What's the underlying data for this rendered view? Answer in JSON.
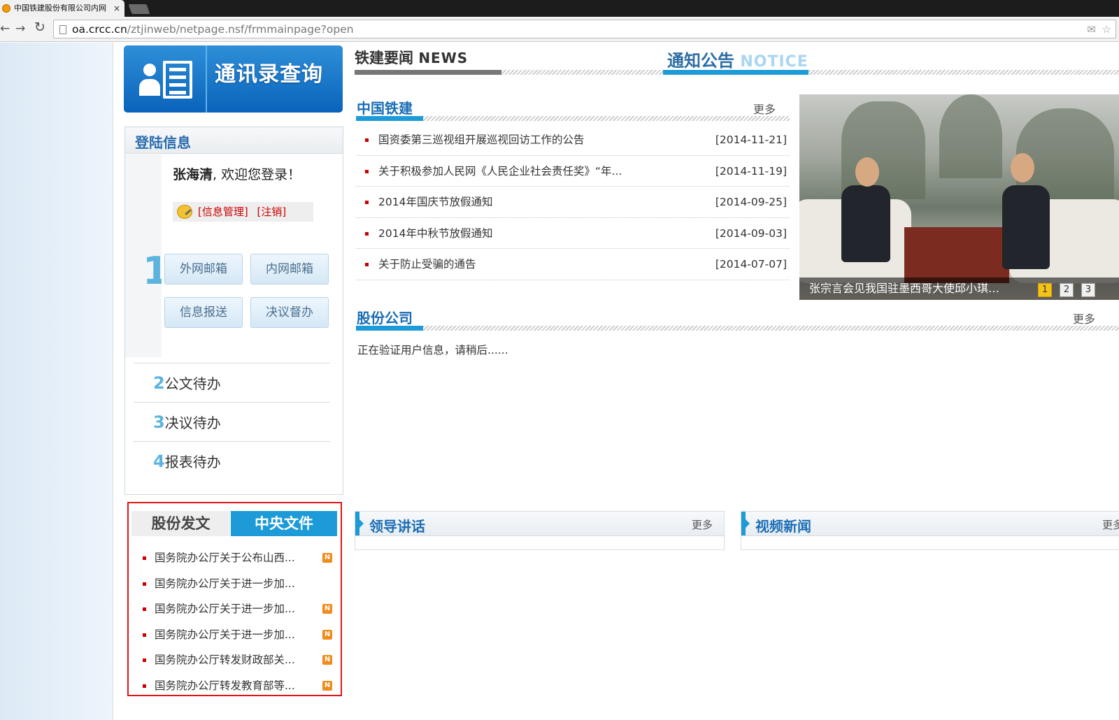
{
  "browser": {
    "tab_title": "中国铁建股份有限公司内网",
    "tab_close": "×",
    "back": "←",
    "forward": "→",
    "reload": "↻",
    "url_domain": "oa.crcc.cn",
    "url_path": "/ztjinweb/netpage.nsf/frmmainpage?open",
    "star": "☆"
  },
  "banner": {
    "title": "通讯录查询"
  },
  "login": {
    "title": "登陆信息",
    "user_name": "张海清",
    "welcome": ", 欢迎您登录！",
    "info_manage": "[信息管理]",
    "logout": "[注销]",
    "step_one": "1",
    "buttons": [
      "外网邮箱",
      "内网邮箱",
      "信息报送",
      "决议督办"
    ],
    "todos": [
      {
        "num": "2",
        "label": "公文待办"
      },
      {
        "num": "3",
        "label": "决议待办"
      },
      {
        "num": "4",
        "label": "报表待办"
      }
    ]
  },
  "docs": {
    "tabs": [
      "股份发文",
      "中央文件"
    ],
    "active_tab": 1,
    "badge": "N",
    "items": [
      {
        "title": "国务院办公厅关于公布山西...",
        "new": true
      },
      {
        "title": "国务院办公厅关于进一步加...",
        "new": false
      },
      {
        "title": "国务院办公厅关于进一步加...",
        "new": true
      },
      {
        "title": "国务院办公厅关于进一步加...",
        "new": true
      },
      {
        "title": "国务院办公厅转发财政部关...",
        "new": true
      },
      {
        "title": "国务院办公厅转发教育部等...",
        "new": true
      }
    ]
  },
  "news_tabs": {
    "news_cn": "铁建要闻",
    "news_en": "NEWS",
    "notice_cn": "通知公告",
    "notice_en": "NOTICE"
  },
  "crcc_section": {
    "title": "中国铁建",
    "more": "更多",
    "items": [
      {
        "title": "国资委第三巡视组开展巡视回访工作的公告",
        "date": "[2014-11-21]"
      },
      {
        "title": "关于积极参加人民网《人民企业社会责任奖》“年...",
        "date": "[2014-11-19]"
      },
      {
        "title": "2014年国庆节放假通知",
        "date": "[2014-09-25]"
      },
      {
        "title": "2014年中秋节放假通知",
        "date": "[2014-09-03]"
      },
      {
        "title": "关于防止受骗的通告",
        "date": "[2014-07-07]"
      }
    ]
  },
  "slideshow": {
    "caption": "张宗言会见我国驻墨西哥大使邱小琪…",
    "pages": [
      "1",
      "2",
      "3"
    ],
    "active_page": 0
  },
  "company_section": {
    "title": "股份公司",
    "more": "更多",
    "loading": "正在验证用户信息，请稍后......"
  },
  "leader_box": {
    "title": "领导讲话",
    "more": "更多"
  },
  "video_box": {
    "title": "视频新闻",
    "more": "更多"
  },
  "colors": {
    "accent_blue": "#1d9ad8",
    "title_blue": "#1a6db5",
    "bullet_red": "#cc0000",
    "highlight_border": "#e01515"
  }
}
